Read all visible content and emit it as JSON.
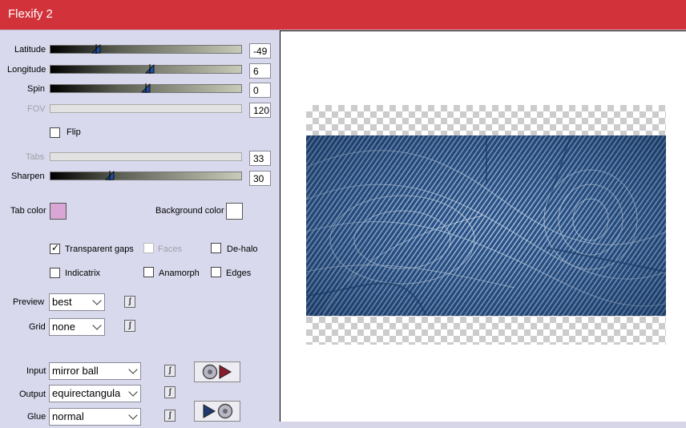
{
  "window": {
    "title": "Flexify 2"
  },
  "sliders": [
    {
      "label": "Latitude",
      "value": "-49",
      "fraction": 0.24,
      "enabled": true
    },
    {
      "label": "Longitude",
      "value": "6",
      "fraction": 0.52,
      "enabled": true
    },
    {
      "label": "Spin",
      "value": "0",
      "fraction": 0.5,
      "enabled": true
    },
    {
      "label": "FOV",
      "value": "120",
      "fraction": null,
      "enabled": false
    },
    {
      "label": "Tabs",
      "value": "33",
      "fraction": null,
      "enabled": false
    },
    {
      "label": "Sharpen",
      "value": "30",
      "fraction": 0.31,
      "enabled": true
    }
  ],
  "flip": {
    "label": "Flip",
    "checked": false
  },
  "tab_color": {
    "label": "Tab color",
    "color": "#d9a6d6"
  },
  "background_color": {
    "label": "Background color",
    "color": "#ffffff"
  },
  "options": {
    "transparent_gaps": {
      "label": "Transparent gaps",
      "checked": true,
      "enabled": true
    },
    "faces": {
      "label": "Faces",
      "checked": false,
      "enabled": false
    },
    "de_halo": {
      "label": "De-halo",
      "checked": false,
      "enabled": true
    },
    "indicatrix": {
      "label": "Indicatrix",
      "checked": false,
      "enabled": true
    },
    "anamorph": {
      "label": "Anamorph",
      "checked": false,
      "enabled": true
    },
    "edges": {
      "label": "Edges",
      "checked": false,
      "enabled": true
    }
  },
  "preview_select": {
    "label": "Preview",
    "value": "best"
  },
  "grid_select": {
    "label": "Grid",
    "value": "none"
  },
  "input_select": {
    "label": "Input",
    "value": "mirror ball"
  },
  "output_select": {
    "label": "Output",
    "value": "equirectangula"
  },
  "glue_select": {
    "label": "Glue",
    "value": "normal"
  },
  "icons": {
    "link": "link-icon",
    "input_to_output": "ball-to-arrow-icon",
    "output_to_input": "arrow-to-ball-icon"
  },
  "colors": {
    "titlebar": "#d2333b",
    "panel": "#d8d9ec",
    "image_blue": "#1e4779"
  }
}
